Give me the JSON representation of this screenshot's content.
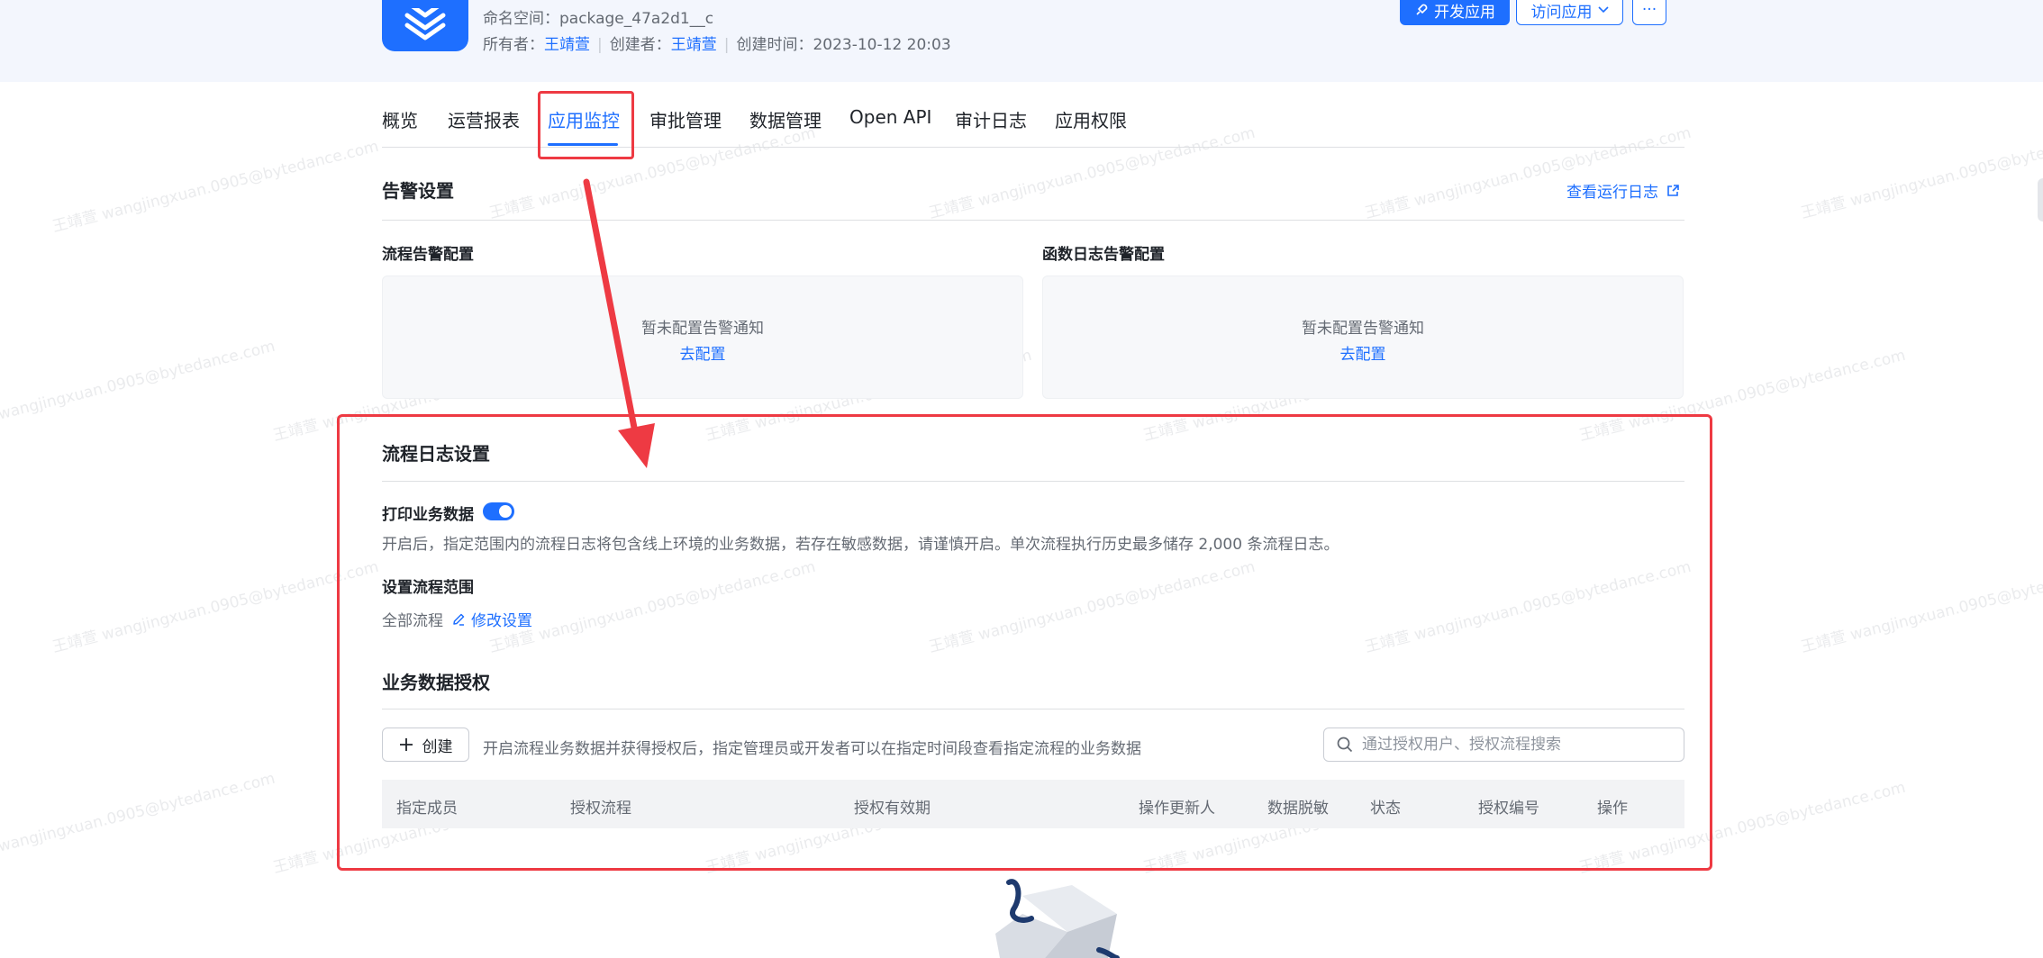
{
  "header": {
    "namespace_label": "命名空间：",
    "namespace_value": "package_47a2d1__c",
    "owner_label": "所有者：",
    "owner_value": "王靖萱",
    "creator_label": "创建者：",
    "creator_value": "王靖萱",
    "created_label": "创建时间：",
    "created_value": "2023-10-12 20:03",
    "dev_button": "开发应用",
    "visit_button": "访问应用",
    "more_button": "···"
  },
  "tabs": [
    "概览",
    "运营报表",
    "应用监控",
    "审批管理",
    "数据管理",
    "Open API",
    "审计日志",
    "应用权限"
  ],
  "active_tab": "应用监控",
  "alert_settings": {
    "title": "告警设置",
    "view_logs_link": "查看运行日志",
    "flow_alert": {
      "title": "流程告警配置",
      "empty_text": "暂未配置告警通知",
      "action": "去配置"
    },
    "function_alert": {
      "title": "函数日志告警配置",
      "empty_text": "暂未配置告警通知",
      "action": "去配置"
    }
  },
  "flow_log": {
    "title": "流程日志设置",
    "print_label": "打印业务数据",
    "print_enabled": true,
    "print_desc": "开启后，指定范围内的流程日志将包含线上环境的业务数据，若存在敏感数据，请谨慎开启。单次流程执行历史最多储存 2,000 条流程日志。",
    "scope_label": "设置流程范围",
    "scope_value": "全部流程",
    "edit_link": "修改设置"
  },
  "authorization": {
    "title": "业务数据授权",
    "create_button": "创建",
    "desc": "开启流程业务数据并获得授权后，指定管理员或开发者可以在指定时间段查看指定流程的业务数据",
    "search_placeholder": "通过授权用户、授权流程搜索",
    "columns": [
      "指定成员",
      "授权流程",
      "授权有效期",
      "操作更新人",
      "数据脱敏",
      "状态",
      "授权编号",
      "操作"
    ]
  },
  "watermark_text": "王靖萱 wangjingxuan.0905@bytedance.com",
  "colors": {
    "primary": "#1e6fff",
    "annotation_red": "#ee3a43",
    "header_bg": "#f3f6fd"
  }
}
